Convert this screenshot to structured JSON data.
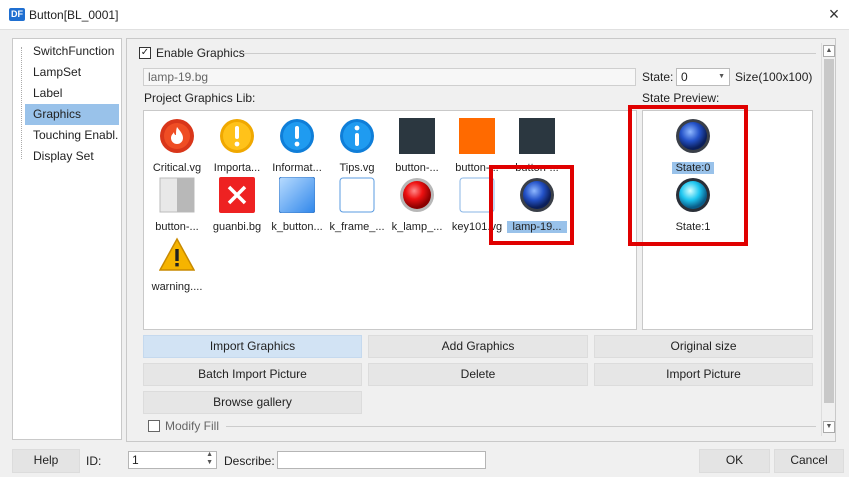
{
  "window": {
    "title": "Button[BL_0001]",
    "app_icon": "DF",
    "close": "×"
  },
  "sidebar": {
    "items": [
      {
        "label": "SwitchFunction"
      },
      {
        "label": "LampSet"
      },
      {
        "label": "Label"
      },
      {
        "label": "Graphics",
        "selected": true
      },
      {
        "label": "Touching Enabl..."
      },
      {
        "label": "Display Set"
      }
    ]
  },
  "graphics": {
    "enable_label": "Enable Graphics",
    "enable_checked": true,
    "file_value": "lamp-19.bg",
    "state_label": "State:",
    "state_value": "0",
    "size_label": "Size(100x100)",
    "lib_label": "Project Graphics Lib:",
    "preview_label": "State Preview:",
    "items": [
      {
        "name": "Critical.vg",
        "icon": "critical-icon"
      },
      {
        "name": "Importa...",
        "icon": "important-icon"
      },
      {
        "name": "Informat...",
        "icon": "information-icon"
      },
      {
        "name": "Tips.vg",
        "icon": "tips-icon"
      },
      {
        "name": "button-...",
        "icon": "button-dark-icon"
      },
      {
        "name": "button-...",
        "icon": "button-orange-icon"
      },
      {
        "name": "button-...",
        "icon": "button-dark-icon"
      },
      {
        "name": "button-...",
        "icon": "button-split-icon"
      },
      {
        "name": "guanbi.bg",
        "icon": "close-red-icon"
      },
      {
        "name": "k_button...",
        "icon": "blue-button-icon"
      },
      {
        "name": "k_frame_...",
        "icon": "frame-icon"
      },
      {
        "name": "k_lamp_...",
        "icon": "red-lamp-icon"
      },
      {
        "name": "key101.vg",
        "icon": "key-icon"
      },
      {
        "name": "lamp-19...",
        "icon": "blue-lamp-icon",
        "selected": true
      },
      {
        "name": "warning....",
        "icon": "warning-icon"
      }
    ],
    "preview": [
      {
        "label": "State:0",
        "icon": "lamp-dark-icon",
        "selected": true
      },
      {
        "label": "State:1",
        "icon": "lamp-cyan-icon"
      }
    ],
    "buttons": {
      "import_graphics": "Import Graphics",
      "add_graphics": "Add Graphics",
      "original_size": "Original size",
      "batch_import": "Batch Import Picture",
      "delete": "Delete",
      "import_picture": "Import Picture",
      "browse_gallery": "Browse gallery"
    },
    "modify_fill": "Modify Fill",
    "modify_fill_checked": false
  },
  "footer": {
    "help": "Help",
    "id_label": "ID:",
    "id_value": "1",
    "describe_label": "Describe:",
    "describe_value": "",
    "ok": "OK",
    "cancel": "Cancel"
  },
  "colors": {
    "highlight": "#e00000",
    "selection": "#99c2ea"
  }
}
